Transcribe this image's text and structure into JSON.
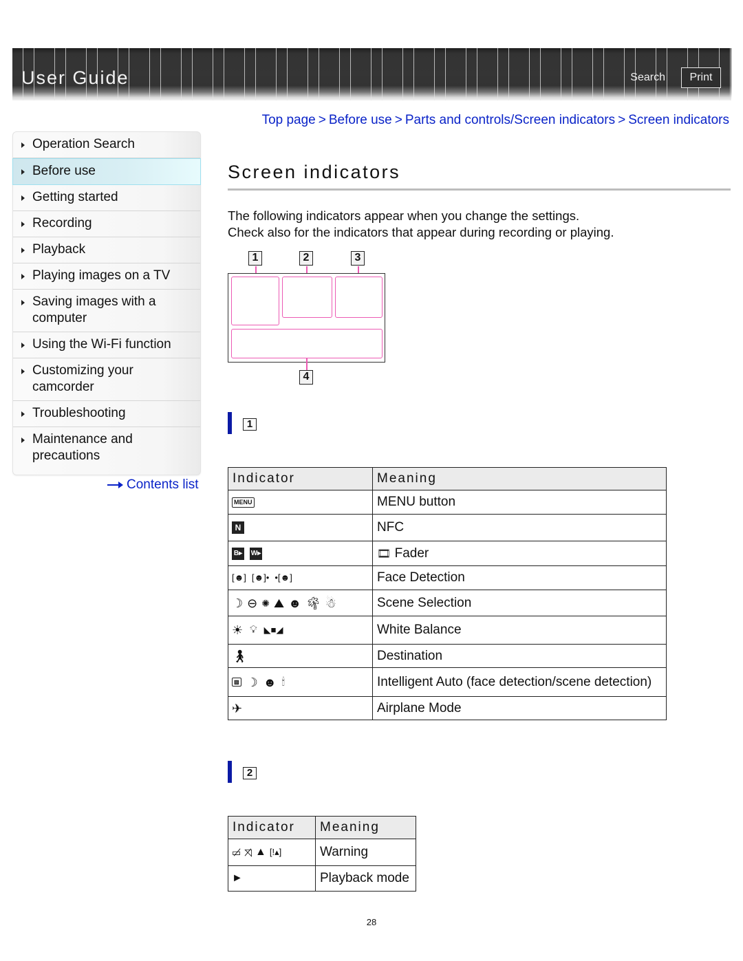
{
  "header": {
    "title": "User Guide",
    "search_label": "Search",
    "print_label": "Print"
  },
  "sidebar": {
    "items": [
      {
        "label": "Operation Search",
        "active": false
      },
      {
        "label": "Before use",
        "active": true
      },
      {
        "label": "Getting started",
        "active": false
      },
      {
        "label": "Recording",
        "active": false
      },
      {
        "label": "Playback",
        "active": false
      },
      {
        "label": "Playing images on a TV",
        "active": false
      },
      {
        "label": "Saving images with a computer",
        "active": false
      },
      {
        "label": "Using the Wi-Fi function",
        "active": false
      },
      {
        "label": "Customizing your camcorder",
        "active": false
      },
      {
        "label": "Troubleshooting",
        "active": false
      },
      {
        "label": "Maintenance and precautions",
        "active": false
      }
    ],
    "contents_link": "Contents list"
  },
  "breadcrumb": {
    "items": [
      "Top page",
      "Before use",
      "Parts and controls/Screen indicators",
      "Screen indicators"
    ],
    "separator": ">"
  },
  "main": {
    "title": "Screen indicators",
    "intro_line1": "The following indicators appear when you change the settings.",
    "intro_line2": "Check also for the indicators that appear during recording or playing.",
    "diagram": {
      "labels": [
        "1",
        "2",
        "3",
        "4"
      ],
      "accent_color": "#ec5ab4"
    },
    "section1": {
      "marker": "1",
      "headers": {
        "indicator": "Indicator",
        "meaning": "Meaning"
      },
      "rows": [
        {
          "icons": [
            "menu-icon"
          ],
          "meaning": "MENU button"
        },
        {
          "icons": [
            "nfc-icon"
          ],
          "meaning": "NFC"
        },
        {
          "icons": [
            "fader-black-icon",
            "fader-white-icon"
          ],
          "meaning_icon": "film-strip-icon",
          "meaning": "Fader"
        },
        {
          "icons": [
            "face-detection-off-icon",
            "face-detection-on-icon",
            "face-detection-child-priority-icon"
          ],
          "meaning": "Face Detection"
        },
        {
          "icons": [
            "night-scene-icon",
            "sunrise-sunset-icon",
            "fireworks-icon",
            "landscape-icon",
            "night-portrait-icon",
            "beach-icon",
            "snow-icon"
          ],
          "meaning": "Scene Selection"
        },
        {
          "icons": [
            "outdoor-wb-icon",
            "indoor-wb-icon",
            "one-push-wb-icon"
          ],
          "meaning": "White Balance"
        },
        {
          "icons": [
            "destination-icon"
          ],
          "meaning": "Destination"
        },
        {
          "icons": [
            "ia-scene-icon",
            "ia-night-icon",
            "ia-portrait-icon",
            "ia-spotlight-icon"
          ],
          "meaning": "Intelligent Auto (face detection/scene detection)"
        },
        {
          "icons": [
            "airplane-icon"
          ],
          "meaning": "Airplane Mode"
        }
      ]
    },
    "section2": {
      "marker": "2",
      "headers": {
        "indicator": "Indicator",
        "meaning": "Meaning"
      },
      "rows": [
        {
          "icons": [
            "battery-warning-icon",
            "card-warning-icon",
            "warning-triangle-icon",
            "media-warning-icon"
          ],
          "meaning": "Warning"
        },
        {
          "icons": [
            "play-icon"
          ],
          "meaning": "Playback mode"
        }
      ]
    },
    "section_bar_color": "#0b1aa5",
    "link_color": "#0a23c8"
  },
  "footer": {
    "page_number": "28"
  }
}
